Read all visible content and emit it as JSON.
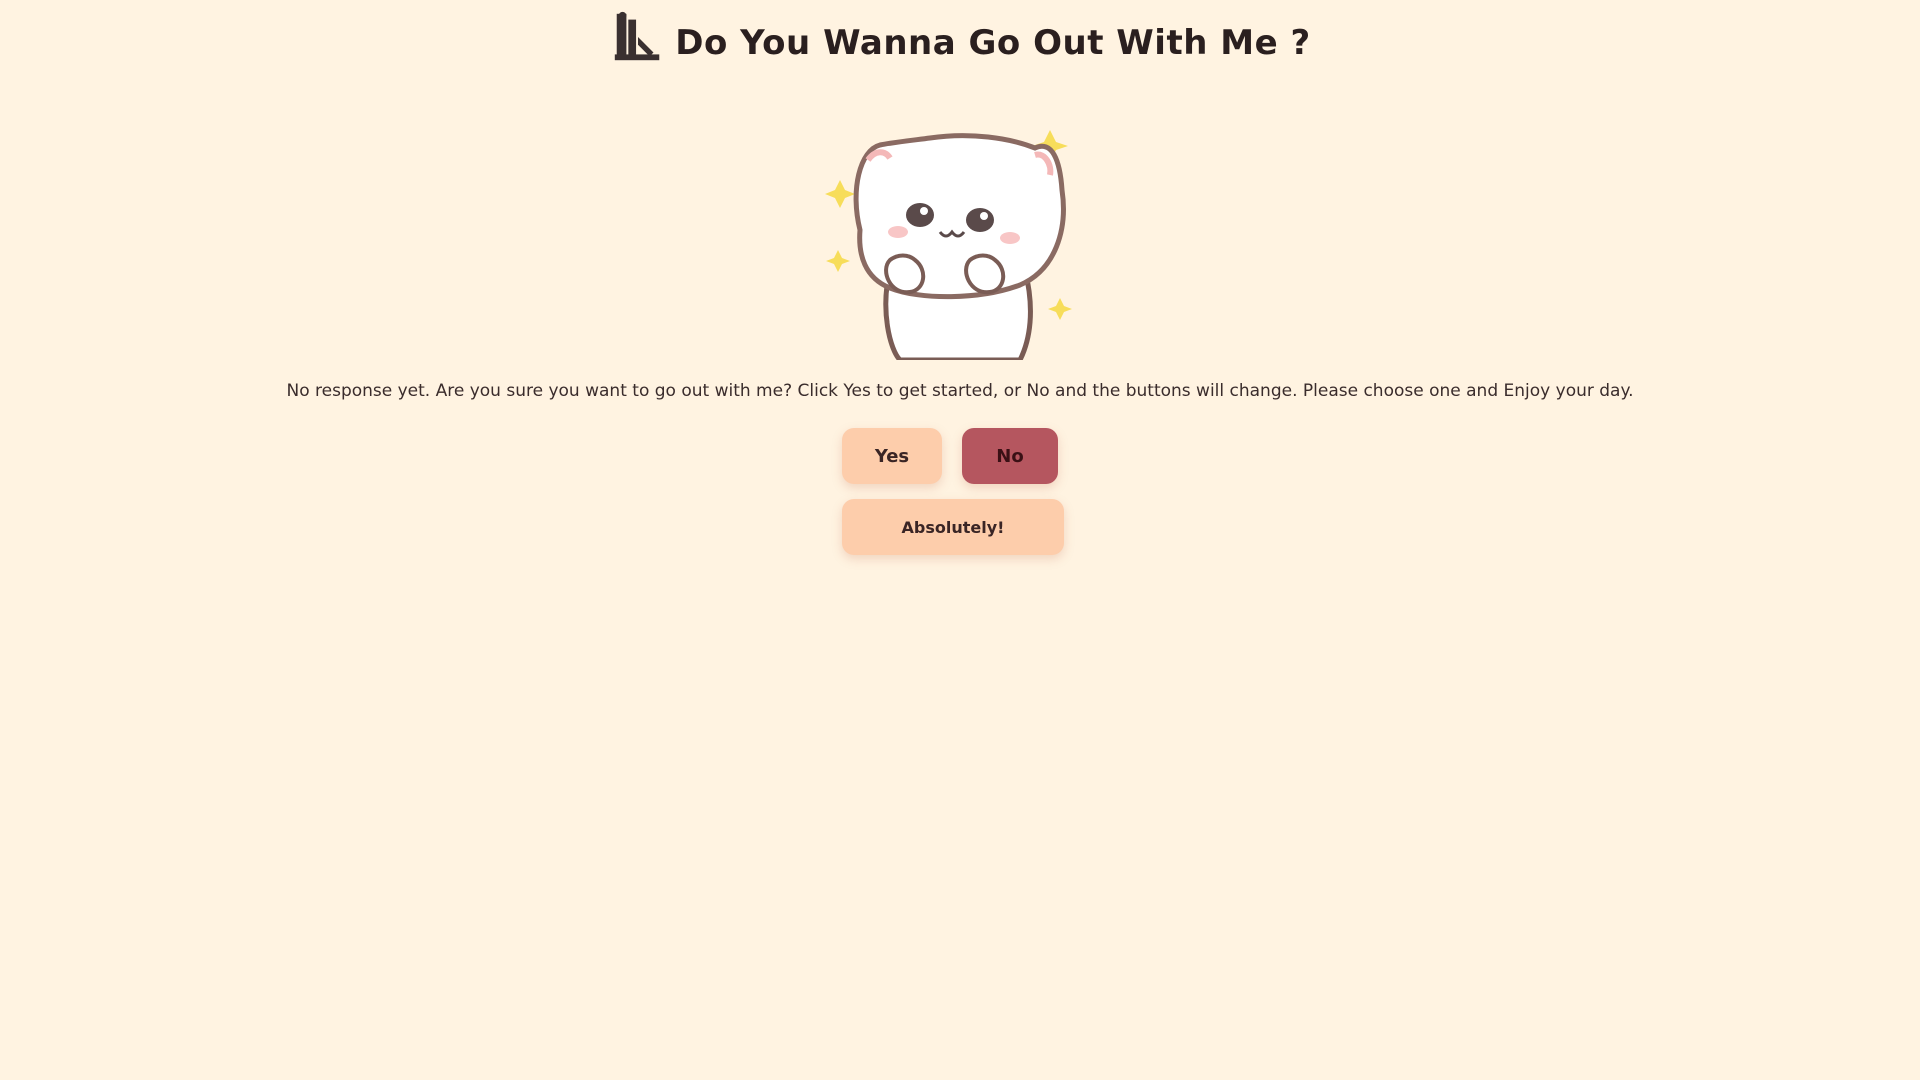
{
  "header": {
    "title": "Do You Wanna Go Out With Me ?",
    "icon": "flower-icon"
  },
  "illustration": {
    "name": "cute-cat-sparkle-illustration"
  },
  "message": {
    "text": "No response yet. Are you sure you want to go out with me? Click Yes to get started, or No and the buttons will change. Please choose one and Enjoy your day."
  },
  "buttons": {
    "yes_label": "Yes",
    "no_label": "No",
    "extra_label": "Absolutely!"
  },
  "colors": {
    "background": "#fff3e1",
    "yes_button": "#fdcdab",
    "no_button": "#b5565f",
    "sparkle": "#f7dd5a"
  }
}
